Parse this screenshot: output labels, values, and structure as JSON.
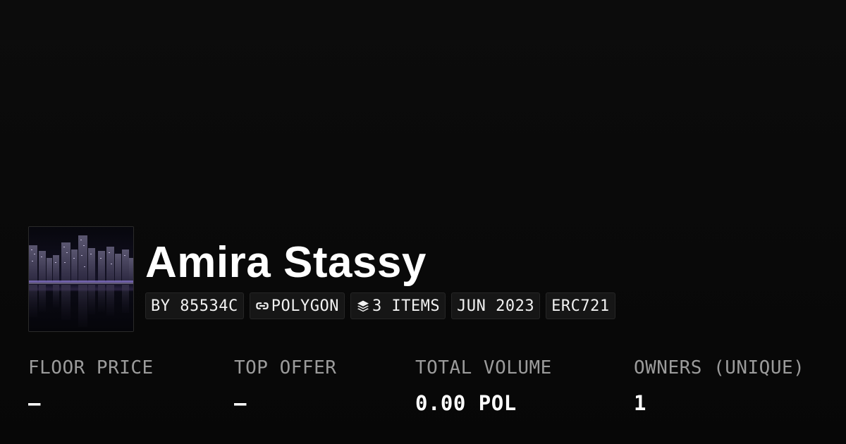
{
  "collection": {
    "title": "Amira Stassy",
    "thumbnail_icon": "city-skyline-night-image"
  },
  "badges": {
    "creator": "BY 85534C",
    "chain": "POLYGON",
    "chain_icon": "polygon-link-icon",
    "items": "3 ITEMS",
    "items_icon": "layers-icon",
    "date": "JUN 2023",
    "standard": "ERC721"
  },
  "stats": [
    {
      "label": "FLOOR PRICE",
      "value": "–"
    },
    {
      "label": "TOP OFFER",
      "value": "–"
    },
    {
      "label": "TOTAL VOLUME",
      "value": "0.00 POL"
    },
    {
      "label": "OWNERS (UNIQUE)",
      "value": "1"
    }
  ],
  "colors": {
    "background": "#0b0b0b",
    "text": "#ffffff",
    "muted": "#9b9b9b",
    "badge_bg": "#161616"
  }
}
